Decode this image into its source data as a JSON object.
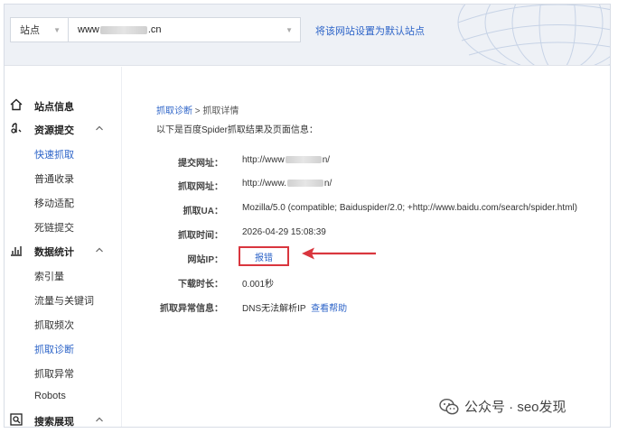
{
  "header": {
    "site_label": "站点",
    "url_prefix": "www",
    "url_suffix": ".cn",
    "default_link": "将该网站设置为默认站点"
  },
  "sidebar": {
    "groups": [
      {
        "label": "站点信息",
        "items": []
      },
      {
        "label": "资源提交",
        "items": [
          "快速抓取",
          "普通收录",
          "移动适配",
          "死链提交"
        ]
      },
      {
        "label": "数据统计",
        "items": [
          "索引量",
          "流量与关键词",
          "抓取频次",
          "抓取诊断",
          "抓取异常",
          "Robots"
        ]
      },
      {
        "label": "搜索展现",
        "items": []
      }
    ],
    "active_item": "抓取诊断"
  },
  "main": {
    "breadcrumb": {
      "parent": "抓取诊断",
      "separator": " > ",
      "current": "抓取详情"
    },
    "intro": "以下是百度Spider抓取结果及页面信息：",
    "rows": [
      {
        "label": "提交网址：",
        "value_prefix": "http://www",
        "value_suffix": "n/"
      },
      {
        "label": "抓取网址：",
        "value_prefix": "http://www.",
        "value_suffix": "n/"
      },
      {
        "label": "抓取UA：",
        "value": "Mozilla/5.0 (compatible; Baiduspider/2.0; +http://www.baidu.com/search/spider.html)"
      },
      {
        "label": "抓取时间：",
        "value": "2026-04-29 15:08:39"
      },
      {
        "label": "网站IP：",
        "value": "报错"
      },
      {
        "label": "下载时长：",
        "value": "0.001秒"
      },
      {
        "label": "抓取异常信息：",
        "value": "DNS无法解析IP",
        "link": "查看帮助"
      }
    ]
  },
  "watermark": {
    "text": "公众号 · seo发现"
  },
  "colors": {
    "link": "#2d64c8",
    "highlight": "#d9363e",
    "header_bg": "#eef1f6"
  }
}
